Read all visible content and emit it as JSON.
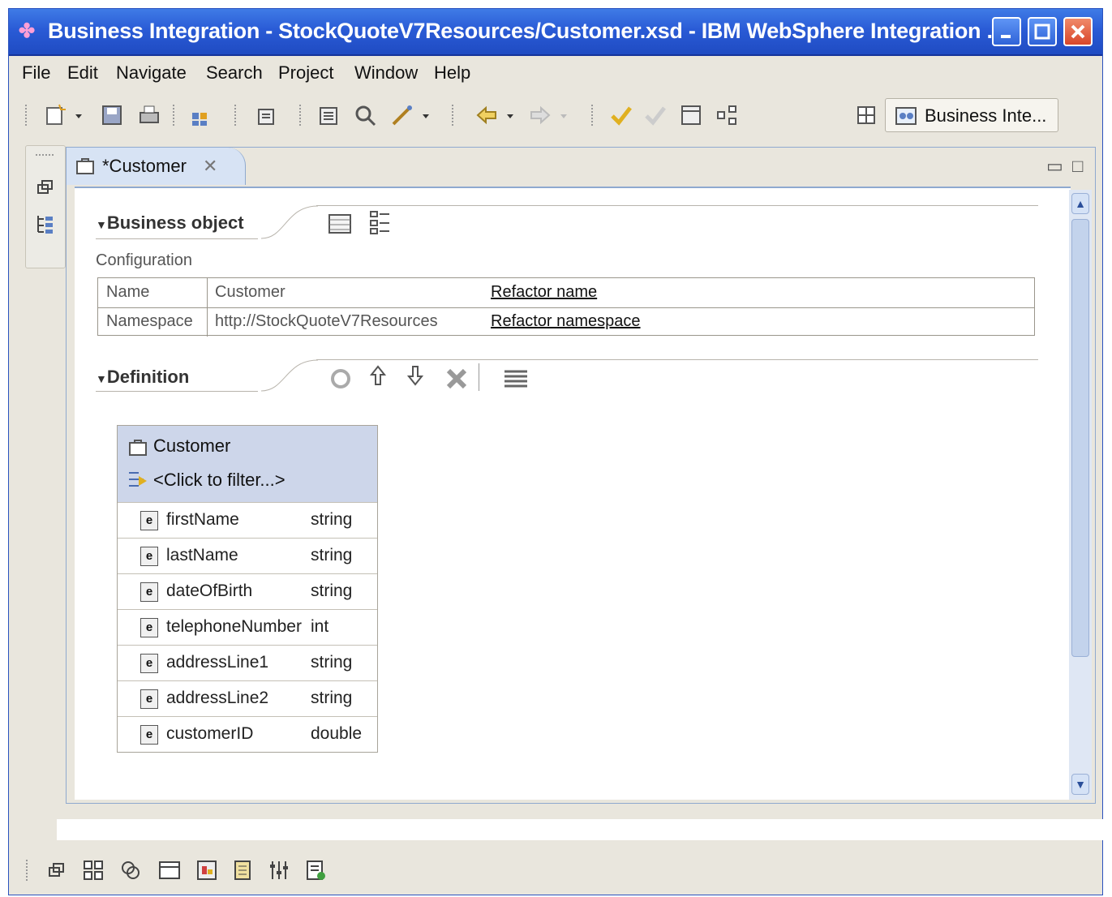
{
  "window": {
    "title": "Business Integration - StockQuoteV7Resources/Customer.xsd - IBM WebSphere Integration ..."
  },
  "menu": [
    "File",
    "Edit",
    "Navigate",
    "Search",
    "Project",
    "Window",
    "Help"
  ],
  "toolbar": {
    "perspective_label": "Business Inte..."
  },
  "editor": {
    "tab_label": "*Customer",
    "business_object": {
      "section_title": "Business object",
      "configuration_label": "Configuration",
      "rows": [
        {
          "label": "Name",
          "value": "Customer",
          "link": "Refactor name"
        },
        {
          "label": "Namespace",
          "value": "http://StockQuoteV7Resources",
          "link": "Refactor namespace"
        }
      ]
    },
    "definition": {
      "section_title": "Definition",
      "bo_name": "Customer",
      "filter_placeholder": "<Click to filter...>",
      "fields": [
        {
          "name": "firstName",
          "type": "string"
        },
        {
          "name": "lastName",
          "type": "string"
        },
        {
          "name": "dateOfBirth",
          "type": "string"
        },
        {
          "name": "telephoneNumber",
          "type": "int"
        },
        {
          "name": "addressLine1",
          "type": "string"
        },
        {
          "name": "addressLine2",
          "type": "string"
        },
        {
          "name": "customerID",
          "type": "double"
        }
      ],
      "element_badge": "e"
    }
  },
  "colors": {
    "titlebar": "#2a5bd6",
    "editor_border": "#8fa9cf",
    "bo_header": "#cdd6ea",
    "close_button": "#d8462a"
  },
  "icons": {
    "app": "websphere-app-icon",
    "toolbar": [
      "new-wizard-icon",
      "save-icon",
      "print-icon",
      "new-module-icon",
      "open-type-icon",
      "open-resource-icon",
      "search-icon",
      "deploy-icon",
      "back-icon",
      "forward-icon",
      "test-icon",
      "debug-icon",
      "properties-icon",
      "hierarchy-icon",
      "open-perspective-icon"
    ],
    "definition_toolbar": [
      "add-field-icon",
      "move-up-icon",
      "move-down-icon",
      "delete-icon",
      "list-view-icon"
    ],
    "bottom": [
      "restore-icon",
      "outline-icon",
      "refresh-icon",
      "console-icon",
      "problems-icon",
      "servers-icon",
      "bindings-icon",
      "tasks-icon"
    ]
  }
}
